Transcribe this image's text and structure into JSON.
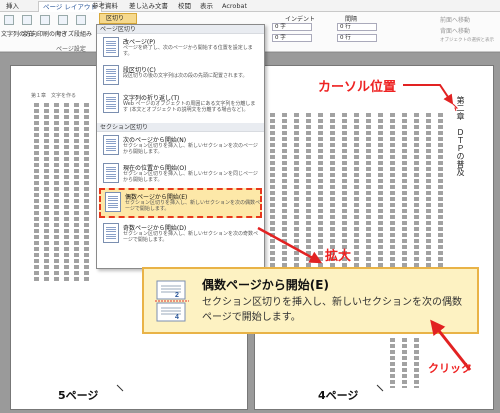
{
  "ribbon": {
    "tabs": [
      "挿入",
      "ページ レイアウト",
      "参考資料",
      "差し込み文書",
      "校閲",
      "表示",
      "Acrobat"
    ],
    "active_tab": "ページ レイアウト",
    "break_button_label": "区切り",
    "indent_label": "インデント",
    "spacing_label": "間隔",
    "fields": [
      "0 字",
      "0 字",
      "0 行",
      "0 行"
    ],
    "right_items": [
      "前面へ移動",
      "背面へ移動",
      "オブジェクトの選択と表示"
    ],
    "left_items": [
      "文字列の方向",
      "余白",
      "印刷の向き",
      "サイズ",
      "段組み"
    ],
    "group_label": "ページ設定"
  },
  "menu": {
    "section_page": "ページ区切り",
    "section_section": "セクション区切り",
    "items": [
      {
        "title": "改ページ(P)",
        "desc": "ページを終了し、次のページから開始する位置を設定します。"
      },
      {
        "title": "段区切り(C)",
        "desc": "段区切りの後の文字列は次の段の先頭に配置されます。"
      },
      {
        "title": "文字列の折り返し(T)",
        "desc": "Web ページのオブジェクトの周囲にある文字列を分離します (本文とオブジェクトの説明文を分離する場合など)。"
      },
      {
        "title": "次のページから開始(N)",
        "desc": "セクション区切りを挿入し、新しいセクションを次のページから開始します。"
      },
      {
        "title": "現在の位置から開始(O)",
        "desc": "セクション区切りを挿入し、新しいセクションを同じページから開始します。"
      },
      {
        "title": "偶数ページから開始(E)",
        "desc": "セクション区切りを挿入し、新しいセクションを次の偶数ページで開始します。"
      },
      {
        "title": "奇数ページから開始(D)",
        "desc": "セクション区切りを挿入し、新しいセクションを次の奇数ページで開始します。"
      }
    ]
  },
  "zoom": {
    "title": "偶数ページから開始(E)",
    "desc": "セクション区切りを挿入し、新しいセクションを次の偶数ページで開始します。"
  },
  "annotations": {
    "cursor": "カーソル位置",
    "zoom": "拡大",
    "click": "クリック",
    "page_left": "5ページ",
    "page_right": "4ページ"
  },
  "document": {
    "chapter_heading": "第二章　ＤＴＰの普及",
    "left_header": "第１章　文字を作る"
  },
  "colors": {
    "highlight": "#fde8a8",
    "callout_bg": "#fdf2c2",
    "annotation_red": "#e22222",
    "ribbon_accent": "#2b579a"
  }
}
